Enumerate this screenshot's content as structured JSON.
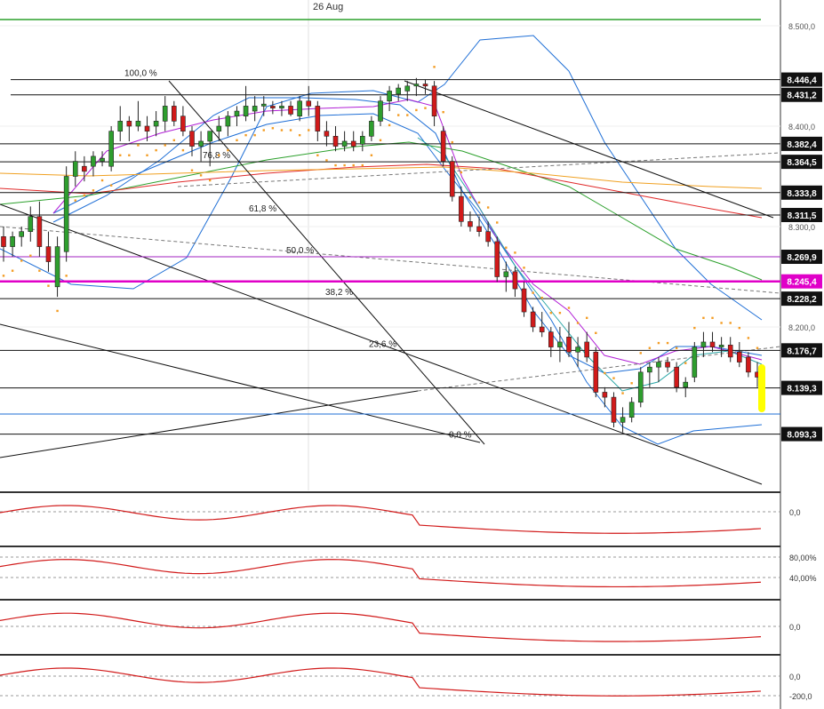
{
  "date_label": "26 Aug",
  "colors": {
    "bull": "#2e9e2e",
    "bear": "#d11a1a",
    "psar": "#f39c23",
    "bollinger": "#1f6fd6",
    "ema_fast": "#b11fd6",
    "ema_teal": "#2aa6a6",
    "ema_green": "#2ca02c",
    "ema_red": "#e02a2a",
    "ema_orange": "#f0a020",
    "magenta_level": "#e000c8",
    "marker": "#ffff00"
  },
  "chart_data": {
    "type": "candlestick",
    "y_ticks": [
      "8.500,0",
      "8.400,0",
      "8.300,0",
      "8.200,0"
    ],
    "ylim": [
      8040,
      8510
    ],
    "price_levels": [
      {
        "label": "8.446,4",
        "value": 8446.4
      },
      {
        "label": "8.431,2",
        "value": 8431.2
      },
      {
        "label": "8.382,4",
        "value": 8382.4
      },
      {
        "label": "8.364,5",
        "value": 8364.5
      },
      {
        "label": "8.333,8",
        "value": 8333.8
      },
      {
        "label": "8.311,5",
        "value": 8311.5
      },
      {
        "label": "8.269,9",
        "value": 8269.9
      },
      {
        "label": "8.245,4",
        "value": 8245.4,
        "highlight": true
      },
      {
        "label": "8.228,2",
        "value": 8228.2
      },
      {
        "label": "8.176,7",
        "value": 8176.7
      },
      {
        "label": "8.139,3",
        "value": 8139.3
      },
      {
        "label": "8.093,3",
        "value": 8093.3
      }
    ],
    "fibonacci": [
      {
        "label": "100,0 %",
        "value": 8446.4
      },
      {
        "label": "76,8 %",
        "value": 8364.5
      },
      {
        "label": "61,8 %",
        "value": 8311.5
      },
      {
        "label": "50,0 %",
        "value": 8269.9
      },
      {
        "label": "38,2 %",
        "value": 8228.2
      },
      {
        "label": "23,6 %",
        "value": 8176.7
      },
      {
        "label": "0,0 %",
        "value": 8093.3
      }
    ],
    "candles": [
      [
        8290,
        8300,
        8265,
        8280
      ],
      [
        8280,
        8295,
        8270,
        8290
      ],
      [
        8290,
        8300,
        8280,
        8295
      ],
      [
        8295,
        8320,
        8285,
        8310
      ],
      [
        8310,
        8325,
        8270,
        8280
      ],
      [
        8280,
        8295,
        8255,
        8265
      ],
      [
        8240,
        8290,
        8230,
        8280
      ],
      [
        8275,
        8360,
        8265,
        8350
      ],
      [
        8350,
        8375,
        8340,
        8365
      ],
      [
        8360,
        8370,
        8345,
        8355
      ],
      [
        8360,
        8375,
        8350,
        8370
      ],
      [
        8365,
        8375,
        8360,
        8368
      ],
      [
        8360,
        8400,
        8355,
        8395
      ],
      [
        8395,
        8420,
        8385,
        8405
      ],
      [
        8405,
        8410,
        8385,
        8400
      ],
      [
        8400,
        8425,
        8395,
        8405
      ],
      [
        8400,
        8410,
        8385,
        8395
      ],
      [
        8400,
        8415,
        8390,
        8405
      ],
      [
        8405,
        8430,
        8395,
        8420
      ],
      [
        8420,
        8425,
        8400,
        8405
      ],
      [
        8410,
        8420,
        8390,
        8395
      ],
      [
        8395,
        8400,
        8370,
        8380
      ],
      [
        8380,
        8395,
        8365,
        8385
      ],
      [
        8385,
        8395,
        8360,
        8395
      ],
      [
        8395,
        8410,
        8385,
        8400
      ],
      [
        8400,
        8415,
        8390,
        8410
      ],
      [
        8410,
        8420,
        8400,
        8415
      ],
      [
        8410,
        8440,
        8405,
        8420
      ],
      [
        8415,
        8430,
        8405,
        8420
      ],
      [
        8420,
        8430,
        8410,
        8422
      ],
      [
        8420,
        8425,
        8412,
        8418
      ],
      [
        8418,
        8425,
        8410,
        8420
      ],
      [
        8420,
        8425,
        8410,
        8412
      ],
      [
        8410,
        8430,
        8405,
        8425
      ],
      [
        8425,
        8440,
        8410,
        8420
      ],
      [
        8420,
        8425,
        8385,
        8395
      ],
      [
        8395,
        8405,
        8380,
        8390
      ],
      [
        8390,
        8400,
        8375,
        8380
      ],
      [
        8380,
        8395,
        8375,
        8385
      ],
      [
        8385,
        8395,
        8375,
        8380
      ],
      [
        8382,
        8395,
        8375,
        8390
      ],
      [
        8390,
        8410,
        8385,
        8405
      ],
      [
        8405,
        8430,
        8400,
        8425
      ],
      [
        8425,
        8440,
        8415,
        8435
      ],
      [
        8432,
        8442,
        8425,
        8438
      ],
      [
        8435,
        8445,
        8425,
        8440
      ],
      [
        8440,
        8448,
        8430,
        8442
      ],
      [
        8442,
        8446,
        8432,
        8440
      ],
      [
        8440,
        8445,
        8400,
        8410
      ],
      [
        8395,
        8400,
        8360,
        8365
      ],
      [
        8365,
        8370,
        8325,
        8330
      ],
      [
        8330,
        8340,
        8300,
        8305
      ],
      [
        8305,
        8315,
        8295,
        8300
      ],
      [
        8300,
        8310,
        8290,
        8295
      ],
      [
        8295,
        8305,
        8280,
        8285
      ],
      [
        8285,
        8290,
        8245,
        8250
      ],
      [
        8250,
        8265,
        8235,
        8255
      ],
      [
        8255,
        8260,
        8230,
        8238
      ],
      [
        8238,
        8245,
        8210,
        8215
      ],
      [
        8215,
        8220,
        8195,
        8200
      ],
      [
        8200,
        8215,
        8190,
        8195
      ],
      [
        8195,
        8200,
        8170,
        8180
      ],
      [
        8180,
        8200,
        8165,
        8185
      ],
      [
        8190,
        8205,
        8170,
        8175
      ],
      [
        8175,
        8190,
        8160,
        8180
      ],
      [
        8185,
        8195,
        8165,
        8170
      ],
      [
        8175,
        8180,
        8130,
        8135
      ],
      [
        8135,
        8140,
        8120,
        8130
      ],
      [
        8130,
        8135,
        8100,
        8105
      ],
      [
        8105,
        8120,
        8095,
        8110
      ],
      [
        8110,
        8130,
        8105,
        8125
      ],
      [
        8125,
        8160,
        8120,
        8155
      ],
      [
        8155,
        8165,
        8140,
        8160
      ],
      [
        8160,
        8170,
        8145,
        8165
      ],
      [
        8165,
        8170,
        8155,
        8160
      ],
      [
        8160,
        8165,
        8135,
        8140
      ],
      [
        8140,
        8150,
        8130,
        8145
      ],
      [
        8150,
        8185,
        8145,
        8180
      ],
      [
        8180,
        8195,
        8170,
        8185
      ],
      [
        8185,
        8195,
        8175,
        8180
      ],
      [
        8180,
        8190,
        8170,
        8182
      ],
      [
        8182,
        8190,
        8165,
        8170
      ],
      [
        8175,
        8185,
        8160,
        8165
      ],
      [
        8170,
        8175,
        8150,
        8155
      ],
      [
        8155,
        8165,
        8140,
        8150
      ]
    ],
    "indicator_panels": [
      {
        "name": "macd",
        "ticks": [
          "0,0"
        ]
      },
      {
        "name": "stochastic",
        "ticks": [
          "80,00%",
          "40,00%"
        ]
      },
      {
        "name": "momentum",
        "ticks": [
          "0,0"
        ]
      },
      {
        "name": "cci",
        "ticks": [
          "0,0",
          "-200,0"
        ]
      }
    ]
  }
}
